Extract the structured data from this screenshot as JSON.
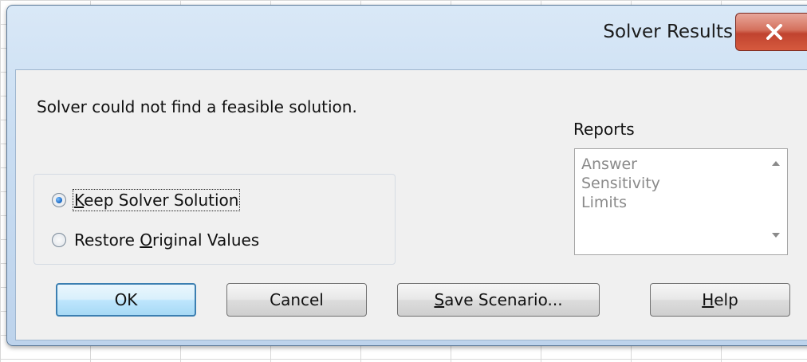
{
  "window": {
    "title": "Solver Results",
    "close_label": "X"
  },
  "message": "Solver could not find a feasible solution.",
  "reports": {
    "label": "Reports",
    "items": [
      "Answer",
      "Sensitivity",
      "Limits"
    ]
  },
  "options": {
    "keep": {
      "prefix": "",
      "accel": "K",
      "rest": "eep Solver Solution",
      "selected": true
    },
    "restore": {
      "prefix": "Restore ",
      "accel": "O",
      "rest": "riginal Values",
      "selected": false
    }
  },
  "buttons": {
    "ok": {
      "prefix": "",
      "accel": "",
      "rest": "OK"
    },
    "cancel": {
      "prefix": "",
      "accel": "",
      "rest": "Cancel"
    },
    "save": {
      "prefix": "",
      "accel": "S",
      "rest": "ave Scenario..."
    },
    "help": {
      "prefix": "",
      "accel": "H",
      "rest": "elp"
    }
  },
  "colors": {
    "accent": "#3c7fb1",
    "close": "#c0432f"
  }
}
